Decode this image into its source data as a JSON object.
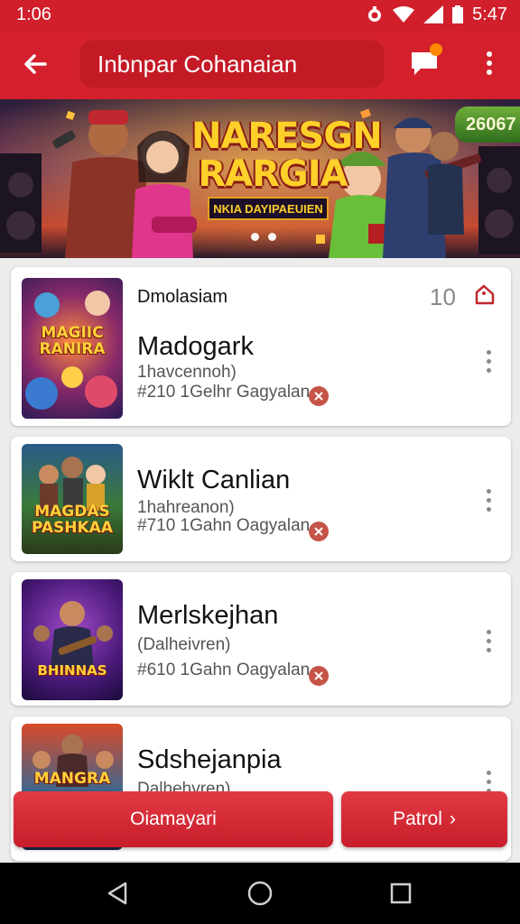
{
  "status_bar": {
    "time": "1:06",
    "clock_right": "5:47",
    "icons": [
      "alarm-icon",
      "wifi-icon",
      "signal-icon",
      "battery-icon"
    ]
  },
  "app_bar": {
    "title": "Inbnpar Cohanaian",
    "icons": [
      "back-arrow-icon",
      "chat-icon",
      "more-vert-icon"
    ],
    "accent": "#d4202c"
  },
  "banner": {
    "title_line1": "NARESGN",
    "title_line2": "RARGIA",
    "subtitle": "NKIA DAYIPAEUIEN",
    "badge": "26067"
  },
  "cards": [
    {
      "category": "Dmolasiam",
      "count": "10",
      "title": "Madogark",
      "subtitle": "1havcennoh)",
      "meta": "#210 1Gelhr Gagyalan",
      "thumb_text": "MAGIIC RANIRA"
    },
    {
      "title": "Wiklt Canlian",
      "subtitle": "1hahreanon)",
      "meta": "#710 1Gahn Oagyalan",
      "thumb_text": "MAGDAS PASHKAA"
    },
    {
      "title": "Merlskejhan",
      "subtitle": "(Dalheivren)",
      "meta": "#610 1Gahn Oagyalan",
      "thumb_text": "BHINNAS"
    },
    {
      "title": "Sdshejanpia",
      "subtitle": "Dalhehvren)",
      "thumb_text": "MANGRA"
    }
  ],
  "actions": {
    "primary": "Oiamayari",
    "next": "Patrol",
    "next_chevron": "›"
  },
  "nav": {
    "icons": [
      "back-nav-icon",
      "home-nav-icon",
      "recents-nav-icon"
    ]
  }
}
